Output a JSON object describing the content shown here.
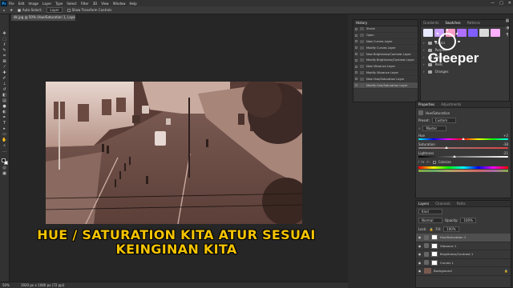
{
  "app": {
    "logo": "Ps"
  },
  "menu": [
    "File",
    "Edit",
    "Image",
    "Layer",
    "Type",
    "Select",
    "Filter",
    "3D",
    "View",
    "Window",
    "Help"
  ],
  "window_controls": [
    "—",
    "□",
    "✕"
  ],
  "options_bar": {
    "auto_select": "Auto-Select:",
    "auto_select_target": "Layer",
    "show_transform": "Show Transform Controls"
  },
  "document": {
    "tab_title": "dk.jpg @ 50% (Hue/Saturation 1, Layer Mask/8) *"
  },
  "status_bar": {
    "zoom": "50%",
    "doc_info": "1920 px x 1080 px (72 ppi)"
  },
  "caption": {
    "line1": "HUE / SATURATION KITA ATUR SESUAI",
    "line2": "KEINGINAN KITA"
  },
  "history": {
    "tabs": [
      "History"
    ],
    "items": [
      "Struts",
      "Open",
      "New Curves Layer",
      "Modify Curves Layer",
      "New Brightness/Contrast Layer",
      "Modify Brightness/Contrast Layer",
      "New Vibrance Layer",
      "Modify Vibrance Layer",
      "New Hue/Saturation Layer",
      "Modify Hue/Saturation Layer"
    ]
  },
  "swatches": {
    "tabs": [
      "Gradients",
      "Swatches",
      "Patterns"
    ],
    "colors": [
      "#e8e8ff",
      "#c9a0ff",
      "#ff9ec8",
      "#b070ff",
      "#7f5fff",
      "#d9d9d9",
      "#ffb0ff"
    ],
    "folders": [
      "Basics",
      "Purples",
      "Pinks",
      "Reds",
      "Oranges"
    ]
  },
  "watermark": {
    "brand": "Gleeper"
  },
  "properties": {
    "tabs": [
      "Properties",
      "Adjustments"
    ],
    "title": "Hue/Saturation",
    "preset_label": "Preset:",
    "preset_value": "Custom",
    "channel": "Master",
    "sliders": [
      {
        "label": "Hue",
        "value": "+2",
        "pos": 0.5
      },
      {
        "label": "Saturation",
        "value": "-38",
        "pos": 0.31
      },
      {
        "label": "Lightness",
        "value": "-21",
        "pos": 0.4
      }
    ],
    "colorize": "Colorize"
  },
  "layers": {
    "tabs": [
      "Layers",
      "Channels",
      "Paths"
    ],
    "kind": "Kind",
    "blend_mode": "Normal",
    "opacity_label": "Opacity:",
    "opacity": "100%",
    "lock_label": "Lock:",
    "fill_label": "Fill:",
    "fill": "100%",
    "rows": [
      {
        "name": "Hue/Saturation 1",
        "type": "adjustment",
        "active": true
      },
      {
        "name": "Vibrance 1",
        "type": "adjustment",
        "active": false
      },
      {
        "name": "Brightness/Contrast 1",
        "type": "adjustment",
        "active": false
      },
      {
        "name": "Curves 1",
        "type": "adjustment",
        "active": false
      },
      {
        "name": "Background",
        "type": "image",
        "active": false
      }
    ]
  }
}
